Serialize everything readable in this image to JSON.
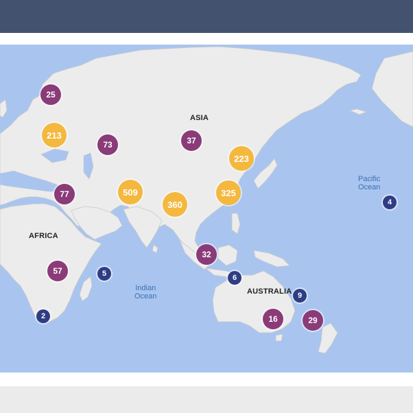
{
  "colors": {
    "header": "#43536f",
    "water": "#a9c5ef",
    "land": "#ececec",
    "large": "#f4b83e",
    "medium": "#8a3b78",
    "small": "#2f3d84",
    "footer": "#ebebeb"
  },
  "regions": {
    "asia": "ASIA",
    "africa": "AFRICA",
    "australia": "AUSTRALIA"
  },
  "oceans": {
    "pacific_line1": "Pacific",
    "pacific_line2": "Ocean",
    "indian_line1": "Indian",
    "indian_line2": "Ocean"
  },
  "clusters": [
    {
      "id": "scandinavia",
      "count": "25",
      "tier": "medium"
    },
    {
      "id": "ukraine",
      "count": "213",
      "tier": "large"
    },
    {
      "id": "kazakhstan",
      "count": "73",
      "tier": "medium"
    },
    {
      "id": "mongolia",
      "count": "37",
      "tier": "medium"
    },
    {
      "id": "korea",
      "count": "223",
      "tier": "large"
    },
    {
      "id": "egypt",
      "count": "77",
      "tier": "medium"
    },
    {
      "id": "pakistan",
      "count": "509",
      "tier": "large"
    },
    {
      "id": "bangladesh",
      "count": "360",
      "tier": "large"
    },
    {
      "id": "taiwan",
      "count": "325",
      "tier": "large"
    },
    {
      "id": "pacific",
      "count": "4",
      "tier": "small"
    },
    {
      "id": "indonesia",
      "count": "32",
      "tier": "medium"
    },
    {
      "id": "mozambique",
      "count": "57",
      "tier": "medium"
    },
    {
      "id": "madagascar",
      "count": "5",
      "tier": "small"
    },
    {
      "id": "timor",
      "count": "6",
      "tier": "small"
    },
    {
      "id": "queensland",
      "count": "9",
      "tier": "small"
    },
    {
      "id": "south-africa",
      "count": "2",
      "tier": "small"
    },
    {
      "id": "victoria",
      "count": "16",
      "tier": "medium"
    },
    {
      "id": "new-zealand",
      "count": "29",
      "tier": "medium"
    }
  ]
}
